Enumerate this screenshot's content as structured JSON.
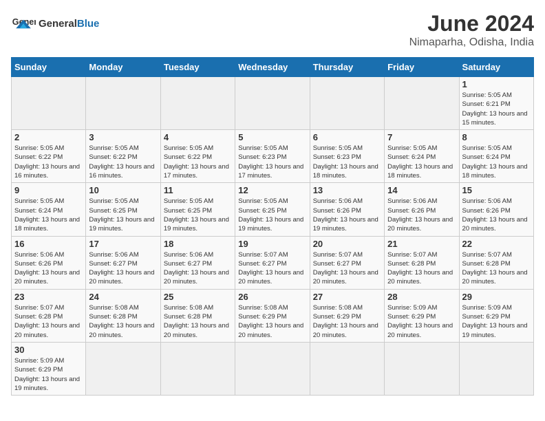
{
  "header": {
    "logo_general": "General",
    "logo_blue": "Blue",
    "month": "June 2024",
    "location": "Nimaparha, Odisha, India"
  },
  "weekdays": [
    "Sunday",
    "Monday",
    "Tuesday",
    "Wednesday",
    "Thursday",
    "Friday",
    "Saturday"
  ],
  "weeks": [
    [
      {
        "day": "",
        "info": ""
      },
      {
        "day": "",
        "info": ""
      },
      {
        "day": "",
        "info": ""
      },
      {
        "day": "",
        "info": ""
      },
      {
        "day": "",
        "info": ""
      },
      {
        "day": "",
        "info": ""
      },
      {
        "day": "1",
        "info": "Sunrise: 5:05 AM\nSunset: 6:21 PM\nDaylight: 13 hours and 15 minutes."
      }
    ],
    [
      {
        "day": "2",
        "info": "Sunrise: 5:05 AM\nSunset: 6:22 PM\nDaylight: 13 hours and 16 minutes."
      },
      {
        "day": "3",
        "info": "Sunrise: 5:05 AM\nSunset: 6:22 PM\nDaylight: 13 hours and 16 minutes."
      },
      {
        "day": "4",
        "info": "Sunrise: 5:05 AM\nSunset: 6:22 PM\nDaylight: 13 hours and 17 minutes."
      },
      {
        "day": "5",
        "info": "Sunrise: 5:05 AM\nSunset: 6:23 PM\nDaylight: 13 hours and 17 minutes."
      },
      {
        "day": "6",
        "info": "Sunrise: 5:05 AM\nSunset: 6:23 PM\nDaylight: 13 hours and 18 minutes."
      },
      {
        "day": "7",
        "info": "Sunrise: 5:05 AM\nSunset: 6:24 PM\nDaylight: 13 hours and 18 minutes."
      },
      {
        "day": "8",
        "info": "Sunrise: 5:05 AM\nSunset: 6:24 PM\nDaylight: 13 hours and 18 minutes."
      }
    ],
    [
      {
        "day": "9",
        "info": "Sunrise: 5:05 AM\nSunset: 6:24 PM\nDaylight: 13 hours and 18 minutes."
      },
      {
        "day": "10",
        "info": "Sunrise: 5:05 AM\nSunset: 6:25 PM\nDaylight: 13 hours and 19 minutes."
      },
      {
        "day": "11",
        "info": "Sunrise: 5:05 AM\nSunset: 6:25 PM\nDaylight: 13 hours and 19 minutes."
      },
      {
        "day": "12",
        "info": "Sunrise: 5:05 AM\nSunset: 6:25 PM\nDaylight: 13 hours and 19 minutes."
      },
      {
        "day": "13",
        "info": "Sunrise: 5:06 AM\nSunset: 6:26 PM\nDaylight: 13 hours and 19 minutes."
      },
      {
        "day": "14",
        "info": "Sunrise: 5:06 AM\nSunset: 6:26 PM\nDaylight: 13 hours and 20 minutes."
      },
      {
        "day": "15",
        "info": "Sunrise: 5:06 AM\nSunset: 6:26 PM\nDaylight: 13 hours and 20 minutes."
      }
    ],
    [
      {
        "day": "16",
        "info": "Sunrise: 5:06 AM\nSunset: 6:26 PM\nDaylight: 13 hours and 20 minutes."
      },
      {
        "day": "17",
        "info": "Sunrise: 5:06 AM\nSunset: 6:27 PM\nDaylight: 13 hours and 20 minutes."
      },
      {
        "day": "18",
        "info": "Sunrise: 5:06 AM\nSunset: 6:27 PM\nDaylight: 13 hours and 20 minutes."
      },
      {
        "day": "19",
        "info": "Sunrise: 5:07 AM\nSunset: 6:27 PM\nDaylight: 13 hours and 20 minutes."
      },
      {
        "day": "20",
        "info": "Sunrise: 5:07 AM\nSunset: 6:27 PM\nDaylight: 13 hours and 20 minutes."
      },
      {
        "day": "21",
        "info": "Sunrise: 5:07 AM\nSunset: 6:28 PM\nDaylight: 13 hours and 20 minutes."
      },
      {
        "day": "22",
        "info": "Sunrise: 5:07 AM\nSunset: 6:28 PM\nDaylight: 13 hours and 20 minutes."
      }
    ],
    [
      {
        "day": "23",
        "info": "Sunrise: 5:07 AM\nSunset: 6:28 PM\nDaylight: 13 hours and 20 minutes."
      },
      {
        "day": "24",
        "info": "Sunrise: 5:08 AM\nSunset: 6:28 PM\nDaylight: 13 hours and 20 minutes."
      },
      {
        "day": "25",
        "info": "Sunrise: 5:08 AM\nSunset: 6:28 PM\nDaylight: 13 hours and 20 minutes."
      },
      {
        "day": "26",
        "info": "Sunrise: 5:08 AM\nSunset: 6:29 PM\nDaylight: 13 hours and 20 minutes."
      },
      {
        "day": "27",
        "info": "Sunrise: 5:08 AM\nSunset: 6:29 PM\nDaylight: 13 hours and 20 minutes."
      },
      {
        "day": "28",
        "info": "Sunrise: 5:09 AM\nSunset: 6:29 PM\nDaylight: 13 hours and 20 minutes."
      },
      {
        "day": "29",
        "info": "Sunrise: 5:09 AM\nSunset: 6:29 PM\nDaylight: 13 hours and 19 minutes."
      }
    ],
    [
      {
        "day": "30",
        "info": "Sunrise: 5:09 AM\nSunset: 6:29 PM\nDaylight: 13 hours and 19 minutes."
      },
      {
        "day": "",
        "info": ""
      },
      {
        "day": "",
        "info": ""
      },
      {
        "day": "",
        "info": ""
      },
      {
        "day": "",
        "info": ""
      },
      {
        "day": "",
        "info": ""
      },
      {
        "day": "",
        "info": ""
      }
    ]
  ]
}
